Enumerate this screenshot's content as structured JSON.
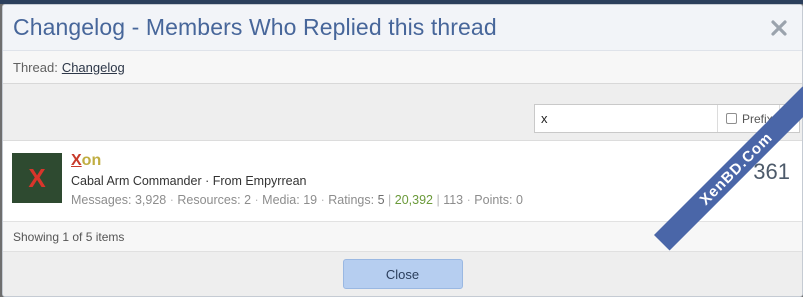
{
  "dialog": {
    "title": "Changelog - Members Who Replied this thread",
    "thread_label": "Thread:",
    "thread_link": "Changelog"
  },
  "filter": {
    "value": "x",
    "prefix_label": "Prefix",
    "prefix_checked": false
  },
  "member": {
    "avatar_letter": "X",
    "name_highlight": "X",
    "name_rest": "on",
    "title_line": "Cabal Arm Commander · From Empyrrean",
    "stats": {
      "messages_label": "Messages:",
      "messages": "3,928",
      "resources_label": "Resources:",
      "resources": "2",
      "media_label": "Media:",
      "media": "19",
      "ratings_label": "Ratings:",
      "ratings": "5",
      "reactions_positive": "20,392",
      "reactions_other": "113",
      "points_label": "Points:",
      "points": "0"
    },
    "reply_count": "361"
  },
  "footer": {
    "status": "Showing 1 of 5 items"
  },
  "actions": {
    "close_label": "Close"
  },
  "watermark": {
    "text": "XenBD.Com"
  },
  "colors": {
    "title": "#47669a",
    "button": "#b6cef0",
    "watermark": "#4a66a8"
  }
}
